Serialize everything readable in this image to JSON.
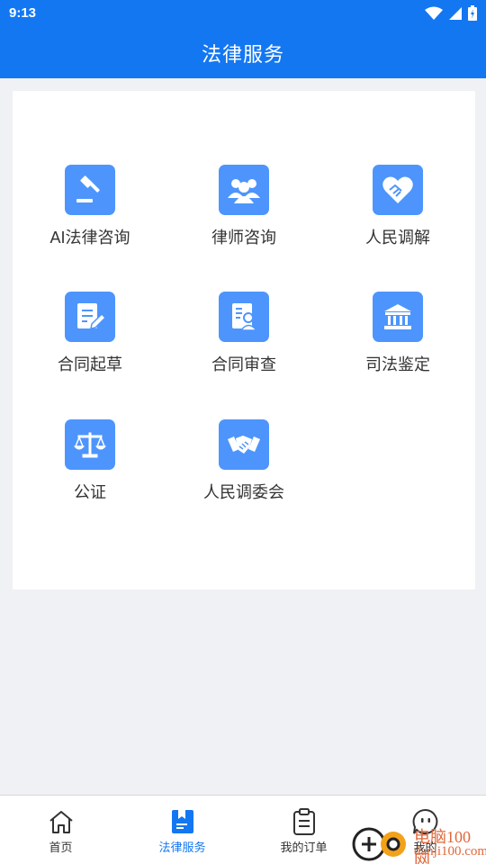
{
  "status_bar": {
    "time": "9:13"
  },
  "header": {
    "title": "法律服务"
  },
  "services": [
    {
      "label": "AI法律咨询",
      "icon": "gavel-icon"
    },
    {
      "label": "律师咨询",
      "icon": "lawyers-icon"
    },
    {
      "label": "人民调解",
      "icon": "heart-handshake-icon"
    },
    {
      "label": "合同起草",
      "icon": "document-edit-icon"
    },
    {
      "label": "合同审查",
      "icon": "document-review-icon"
    },
    {
      "label": "司法鉴定",
      "icon": "courthouse-icon"
    },
    {
      "label": "公证",
      "icon": "scales-icon"
    },
    {
      "label": "人民调委会",
      "icon": "handshake-icon"
    }
  ],
  "bottom_nav": [
    {
      "label": "首页",
      "icon": "home-icon",
      "active": false
    },
    {
      "label": "法律服务",
      "icon": "law-book-icon",
      "active": true
    },
    {
      "label": "我的订单",
      "icon": "clipboard-icon",
      "active": false
    },
    {
      "label": "我的",
      "icon": "chat-face-icon",
      "active": false
    }
  ],
  "watermark": {
    "text": "电脑100网",
    "subtext": "danji100.com"
  },
  "colors": {
    "primary": "#1477f2",
    "icon_bg": "#4d95fc",
    "background": "#f0f1f5"
  }
}
